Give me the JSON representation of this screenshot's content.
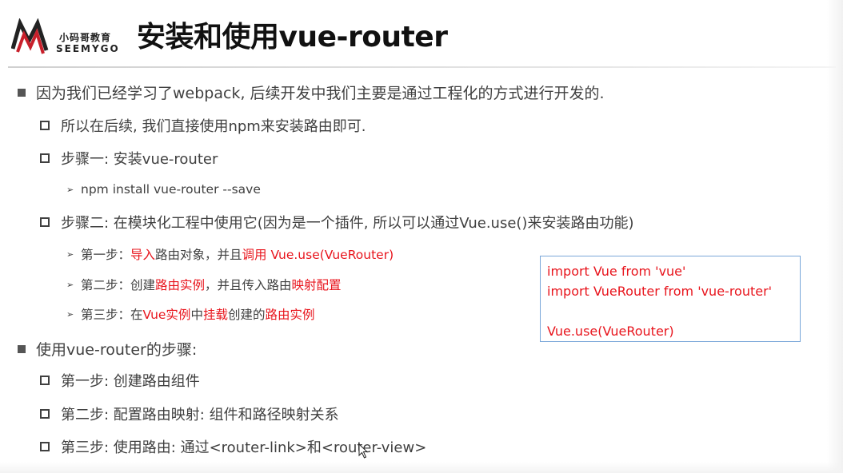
{
  "logo": {
    "cn": "小码哥教育",
    "en": "SEEMYGO",
    "brand_color": "#c8202b"
  },
  "title": "安装和使用vue-router",
  "bullets": {
    "b1": "因为我们已经学习了webpack, 后续开发中我们主要是通过工程化的方式进行开发的.",
    "b1_1": "所以在后续, 我们直接使用npm来安装路由即可.",
    "b1_2": "步骤一: 安装vue-router",
    "b1_2_1": "npm install vue-router --save",
    "b1_3": "步骤二: 在模块化工程中使用它(因为是一个插件, 所以可以通过Vue.use()来安装路由功能)",
    "step1": {
      "p1": "第一步：",
      "r1": "导入",
      "p2": "路由对象，并且",
      "r2": "调用 Vue.use(VueRouter)"
    },
    "step2": {
      "p1": "第二步：创建",
      "r1": "路由实例",
      "p2": "，并且传入路由",
      "r2": "映射配置"
    },
    "step3": {
      "p1": "第三步：在",
      "r1": "Vue实例",
      "p2": "中",
      "r2": "挂载",
      "p3": "创建的",
      "r3": "路由实例"
    },
    "b2": "使用vue-router的步骤:",
    "b2_1": "第一步: 创建路由组件",
    "b2_2": "第二步: 配置路由映射: 组件和路径映射关系",
    "b2_3": "第三步: 使用路由: 通过<router-link>和<router-view>"
  },
  "code": {
    "lines": [
      "import Vue from 'vue'",
      "import VueRouter from 'vue-router'",
      "",
      "Vue.use(VueRouter)"
    ]
  },
  "colors": {
    "text": "#404040",
    "highlight": "#e8141c",
    "code_border": "#7aa7d9"
  },
  "icons": {
    "logo": "seemygo-logo",
    "cursor": "mouse-cursor-icon"
  }
}
